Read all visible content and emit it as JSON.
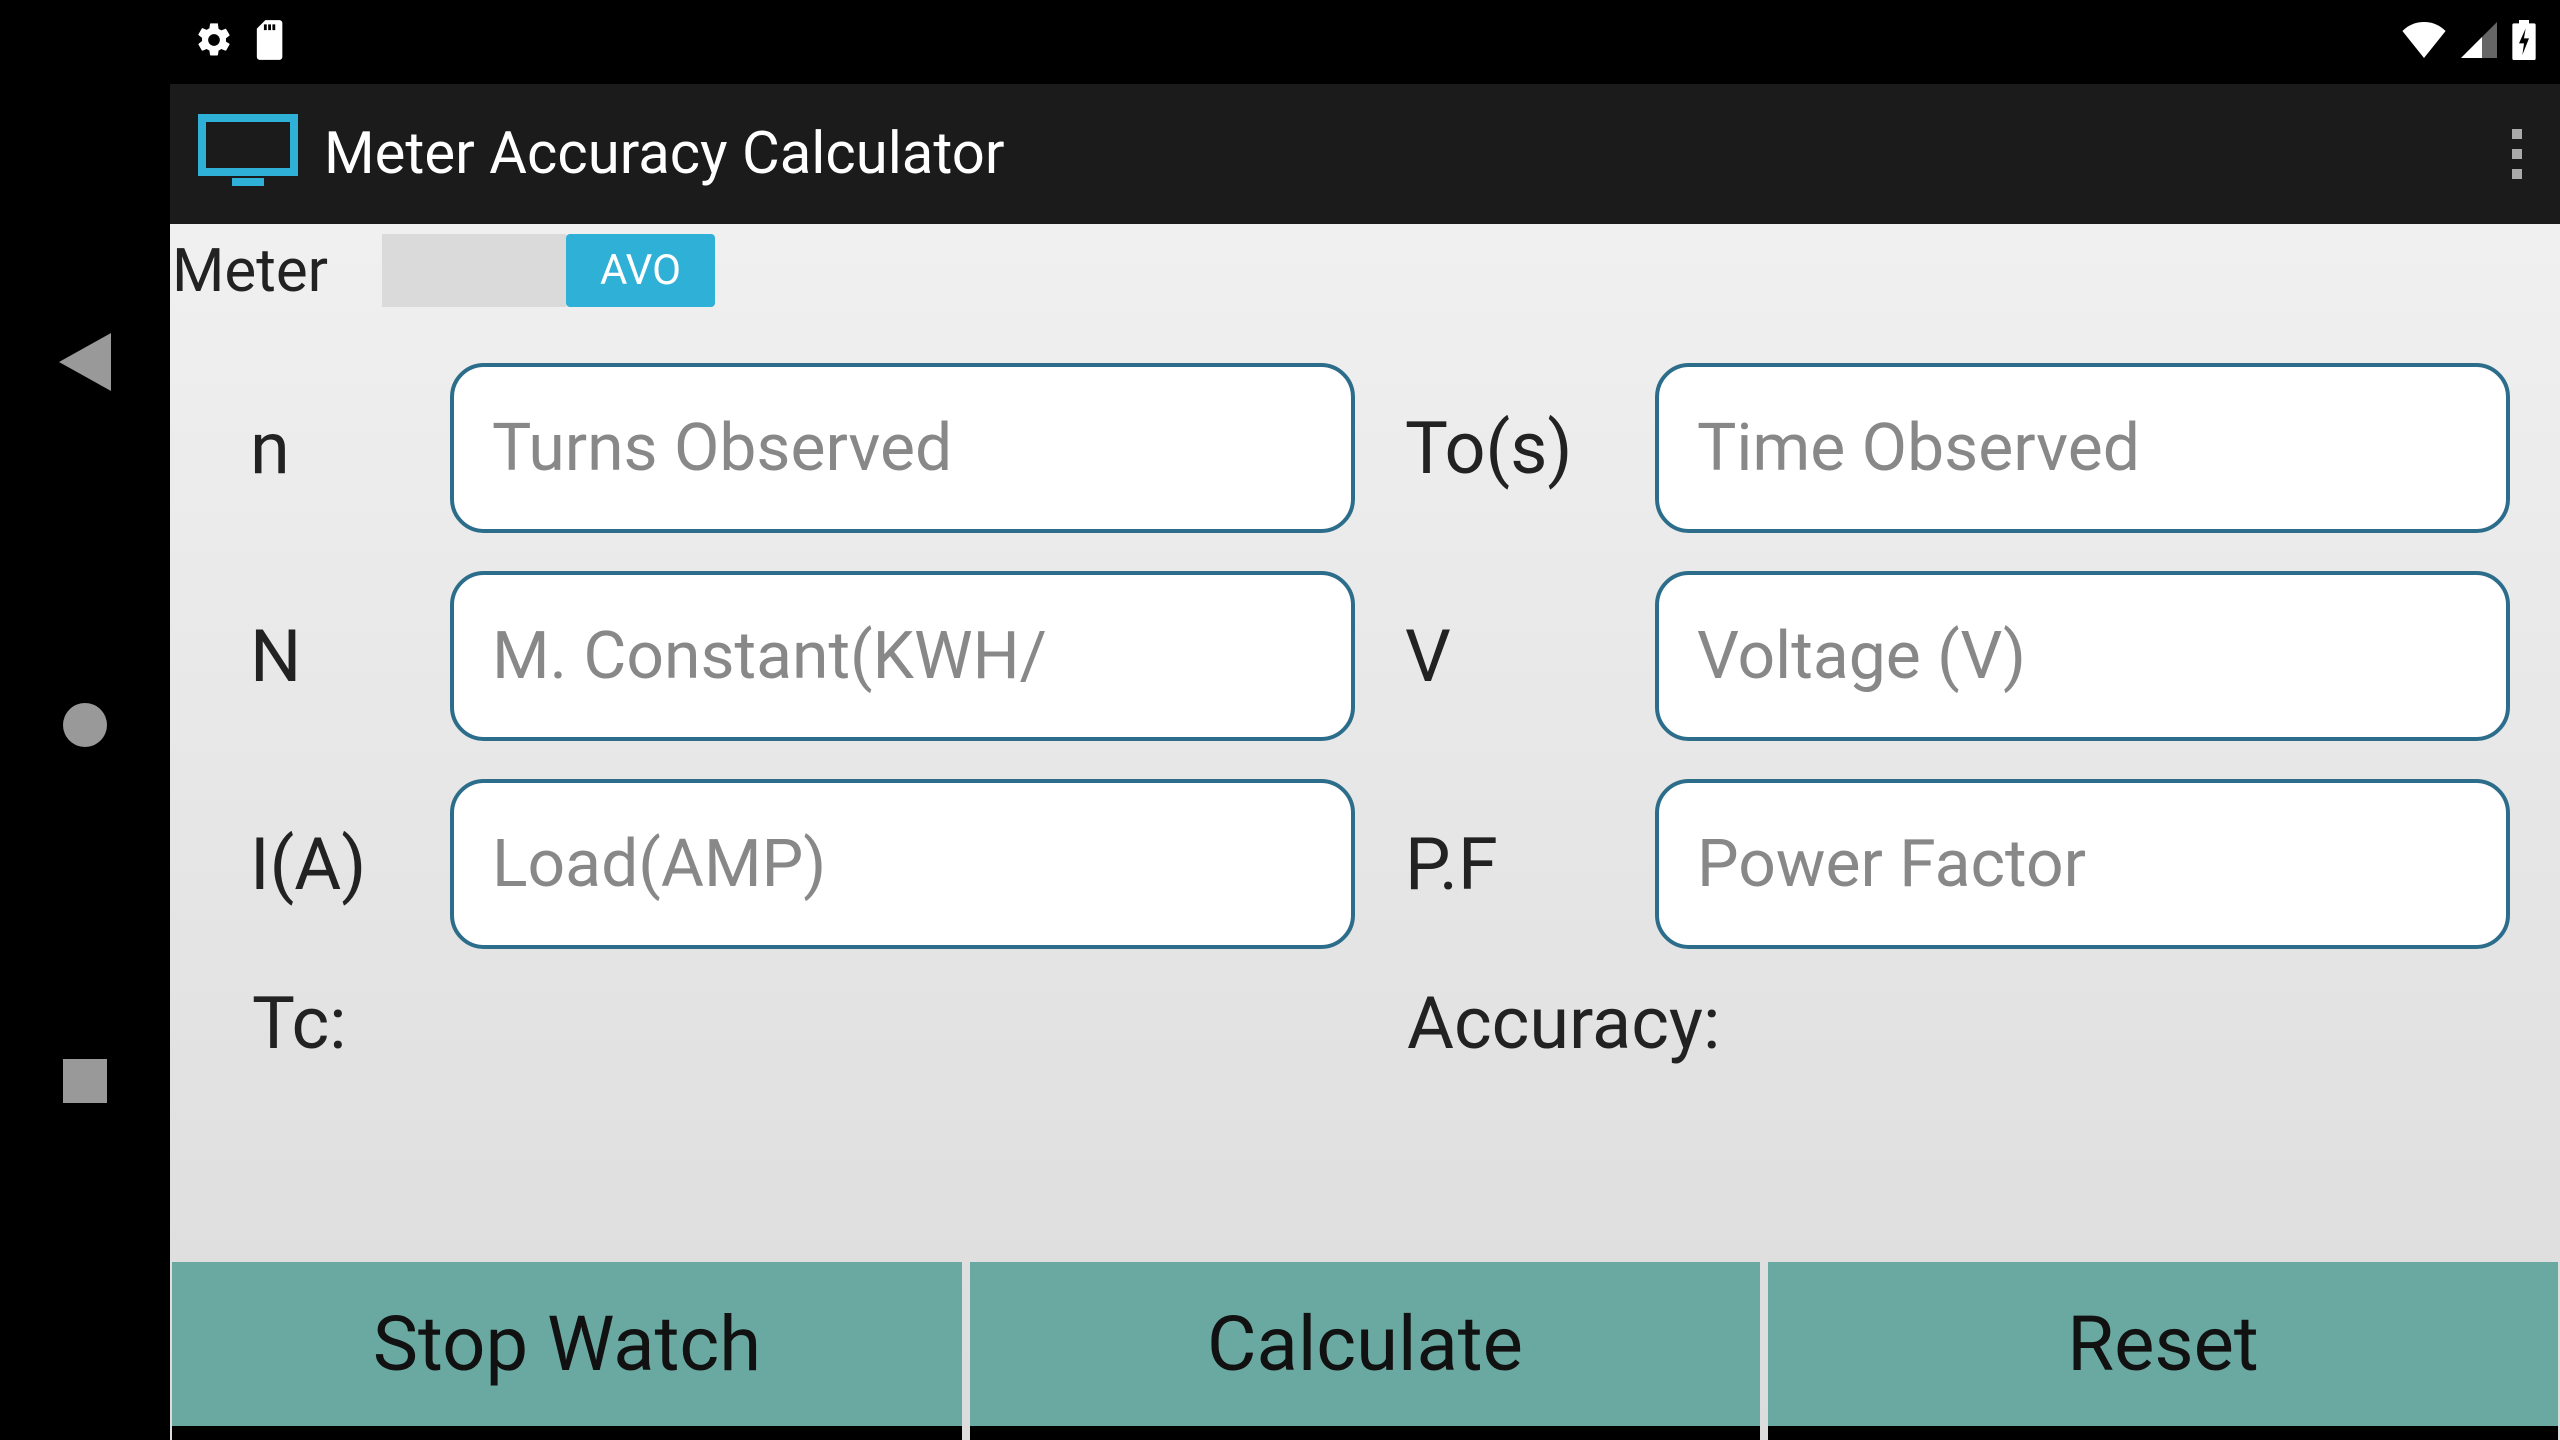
{
  "statusbar": {},
  "appbar": {
    "title": "Meter Accuracy Calculator"
  },
  "meter": {
    "label": "Meter",
    "tab_inactive": "",
    "tab_active": "AVO"
  },
  "fields": {
    "n": {
      "label": "n",
      "placeholder": "Turns Observed"
    },
    "to": {
      "label": "To(s)",
      "placeholder": "Time Observed"
    },
    "N": {
      "label": "N",
      "placeholder": "M. Constant(KWH/"
    },
    "V": {
      "label": "V",
      "placeholder": "Voltage (V)"
    },
    "IA": {
      "label": "I(A)",
      "placeholder": "Load(AMP)"
    },
    "PF": {
      "label": "P.F",
      "placeholder": "Power Factor"
    }
  },
  "results": {
    "tc": "Tc:",
    "accuracy": "Accuracy:"
  },
  "buttons": {
    "stopwatch": "Stop Watch",
    "calculate": "Calculate",
    "reset": "Reset"
  }
}
